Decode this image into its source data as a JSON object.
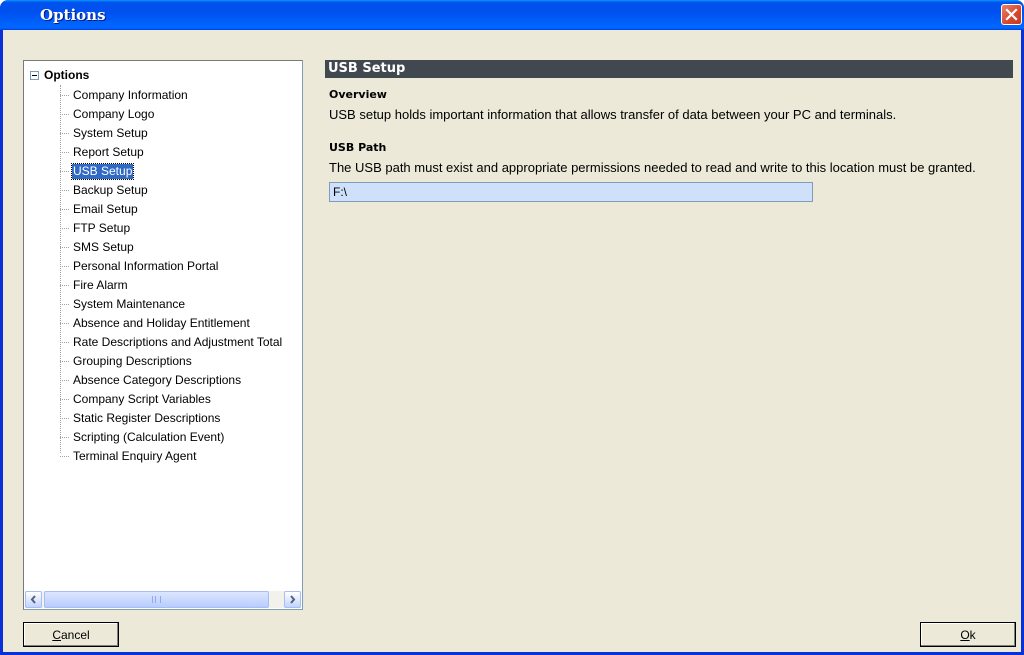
{
  "window": {
    "title": "Options",
    "close_icon": "close-icon"
  },
  "tree": {
    "root_label": "Options",
    "items": [
      {
        "label": "Company Information"
      },
      {
        "label": "Company Logo"
      },
      {
        "label": "System Setup"
      },
      {
        "label": "Report Setup"
      },
      {
        "label": "USB Setup",
        "selected": true
      },
      {
        "label": "Backup Setup"
      },
      {
        "label": "Email Setup"
      },
      {
        "label": "FTP Setup"
      },
      {
        "label": "SMS Setup"
      },
      {
        "label": "Personal Information Portal"
      },
      {
        "label": "Fire Alarm"
      },
      {
        "label": "System Maintenance"
      },
      {
        "label": "Absence and Holiday Entitlement"
      },
      {
        "label": "Rate Descriptions and Adjustment Total"
      },
      {
        "label": "Grouping Descriptions"
      },
      {
        "label": "Absence Category Descriptions"
      },
      {
        "label": "Company Script Variables"
      },
      {
        "label": "Static Register Descriptions"
      },
      {
        "label": "Scripting (Calculation Event)"
      },
      {
        "label": "Terminal Enquiry Agent"
      }
    ]
  },
  "content": {
    "section_title": "USB Setup",
    "overview_heading": "Overview",
    "overview_text": "USB setup holds important information that allows transfer of data between your PC and terminals.",
    "path_heading": "USB Path",
    "path_text": "The USB path must exist and appropriate permissions needed to read and write to this location must be granted.",
    "path_value": "F:\\"
  },
  "buttons": {
    "cancel_first": "C",
    "cancel_rest": "ancel",
    "ok_first": "O",
    "ok_rest": "k"
  },
  "colors": {
    "titlebar": "#0053ee",
    "selection": "#316ac5",
    "section_header_bg": "#41484f",
    "input_bg": "#cfe0fb"
  }
}
